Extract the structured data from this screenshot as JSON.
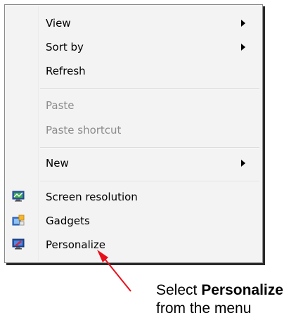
{
  "menu": {
    "items": [
      {
        "label": "View",
        "submenu": true,
        "enabled": true
      },
      {
        "label": "Sort by",
        "submenu": true,
        "enabled": true
      },
      {
        "label": "Refresh",
        "submenu": false,
        "enabled": true
      },
      {
        "label": "Paste",
        "submenu": false,
        "enabled": false
      },
      {
        "label": "Paste shortcut",
        "submenu": false,
        "enabled": false
      },
      {
        "label": "New",
        "submenu": true,
        "enabled": true
      },
      {
        "label": "Screen resolution",
        "icon": "screen-resolution-icon",
        "enabled": true
      },
      {
        "label": "Gadgets",
        "icon": "gadgets-icon",
        "enabled": true
      },
      {
        "label": "Personalize",
        "icon": "personalize-icon",
        "enabled": true
      }
    ]
  },
  "annotation": {
    "prefix": "Select ",
    "bold": "Personalize",
    "line2": "from the menu",
    "arrow_color": "#e8101b"
  }
}
